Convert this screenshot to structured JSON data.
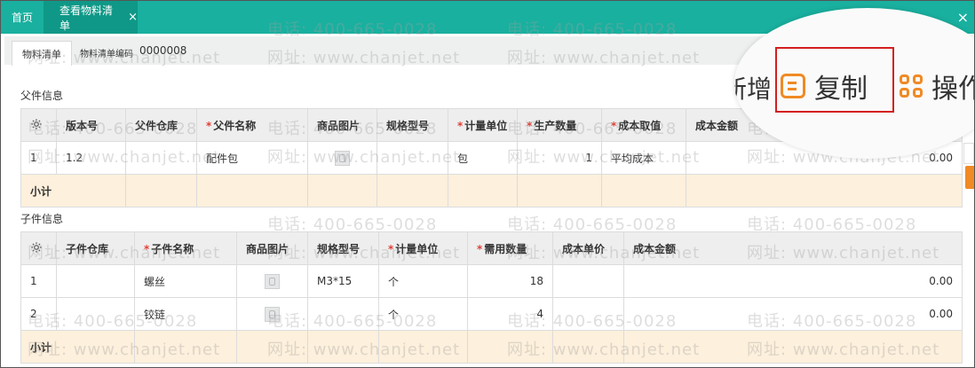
{
  "tabs": {
    "home": "首页",
    "active": "查看物料清单",
    "close_glyph": "×"
  },
  "window_close_glyph": "×",
  "subbar": {
    "tab_label": "物料清单",
    "code_label": "物料清单编码",
    "code_value": "0000008"
  },
  "zoom": {
    "add_partial": "新增",
    "copy_label": "复制",
    "op_partial": "操作"
  },
  "parent": {
    "section_title": "父件信息",
    "columns": [
      "版本号",
      "父件仓库",
      "父件名称",
      "商品图片",
      "规格型号",
      "计量单位",
      "生产数量",
      "成本取值",
      "成本金额"
    ],
    "required": [
      false,
      false,
      true,
      false,
      false,
      true,
      true,
      true,
      false
    ],
    "rows": [
      {
        "idx": "1",
        "version": "1.2",
        "warehouse": "",
        "name": "配件包",
        "spec": "",
        "unit": "包",
        "qty": "1",
        "cost_method": "平均成本",
        "amount": "0.00"
      }
    ],
    "subtotal_label": "小计"
  },
  "child": {
    "section_title": "子件信息",
    "columns": [
      "子件仓库",
      "子件名称",
      "商品图片",
      "规格型号",
      "计量单位",
      "需用数量",
      "成本单价",
      "成本金额"
    ],
    "required": [
      false,
      true,
      false,
      false,
      true,
      true,
      false,
      false
    ],
    "rows": [
      {
        "idx": "1",
        "warehouse": "",
        "name": "螺丝",
        "spec": "M3*15",
        "unit": "个",
        "qty": "18",
        "price": "",
        "amount": "0.00"
      },
      {
        "idx": "2",
        "warehouse": "",
        "name": "铰链",
        "spec": "",
        "unit": "个",
        "qty": "4",
        "price": "",
        "amount": "0.00"
      }
    ],
    "subtotal_label": "小计"
  },
  "watermark": {
    "phone": "电话: 400-665-0028",
    "site": "网址: www.chanjet.net"
  },
  "colors": {
    "header_bar": "#19b09f",
    "active_tab": "#0f9887",
    "required_star": "#e0403a",
    "subtotal_row": "#fdf0dc",
    "accent_orange": "#f08a24",
    "highlight_box": "#d41f1f"
  },
  "icons": {
    "settings": "gear-icon",
    "image": "image-placeholder-icon",
    "copy": "copy-icon",
    "operations": "grid-icon"
  }
}
